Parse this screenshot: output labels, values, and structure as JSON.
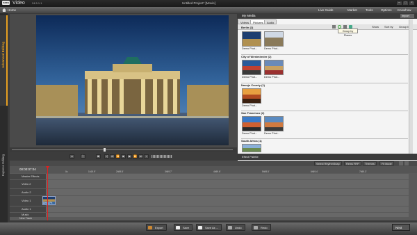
{
  "window": {
    "app_name": "Video",
    "version": "24.5.1.1",
    "project_title": "Untitled Project* [Movie]"
  },
  "menubar": {
    "home": "Home",
    "items": [
      "Live Guide",
      "Market",
      "Tools",
      "Options",
      "Knowhow"
    ]
  },
  "side_tabs": {
    "advanced": "Advanced Editing",
    "express": "Express Editing"
  },
  "media": {
    "header": "My Media",
    "import_label": "Import",
    "tabs": [
      "Videos",
      "Pictures",
      "Audio"
    ],
    "show_label": "Show",
    "sort_label": "Sort by",
    "group_label": "Group by",
    "tooltip": "Group by Places",
    "groups": [
      {
        "name": "Berlin (2)",
        "items": [
          "Demo Phot...",
          "Demo Phot..."
        ]
      },
      {
        "name": "City of Westminster (2)",
        "items": [
          "Demo Phot...",
          "Demo Phot..."
        ]
      },
      {
        "name": "Navajo County (1)",
        "items": [
          "Demo Phot..."
        ]
      },
      {
        "name": "San Francisco (2)",
        "items": [
          "Demo Phot...",
          "Demo Phot..."
        ]
      },
      {
        "name": "South Africa (1)",
        "items": []
      }
    ],
    "effects_label": "Effect Palette"
  },
  "timeline": {
    "timecode": "00:00:07:04",
    "ticks": [
      "0s",
      "1h19.9'",
      "2h59.8'",
      "3h59.7'",
      "4h59.6'",
      "5h59.5'",
      "6h59.4'",
      "7h59.3'"
    ],
    "toolbar": [
      "Select RhythmSnap",
      "Rems FRP",
      "Themes",
      "Fit Mode"
    ],
    "tracks": [
      "Master Effects",
      "Video 2",
      "Audio 2",
      "Video 1",
      "Audio 1",
      "Music"
    ],
    "new_track": "New Track",
    "clip_label": "Demo Ph"
  },
  "bottom": {
    "buttons": [
      "Export",
      "Save",
      "Save As ...",
      "Undo",
      "Redo"
    ],
    "next": "Next"
  },
  "colors": {
    "accent_orange": "#e8a020",
    "playhead": "#e02020",
    "bg_dark": "#3a3a3a"
  }
}
